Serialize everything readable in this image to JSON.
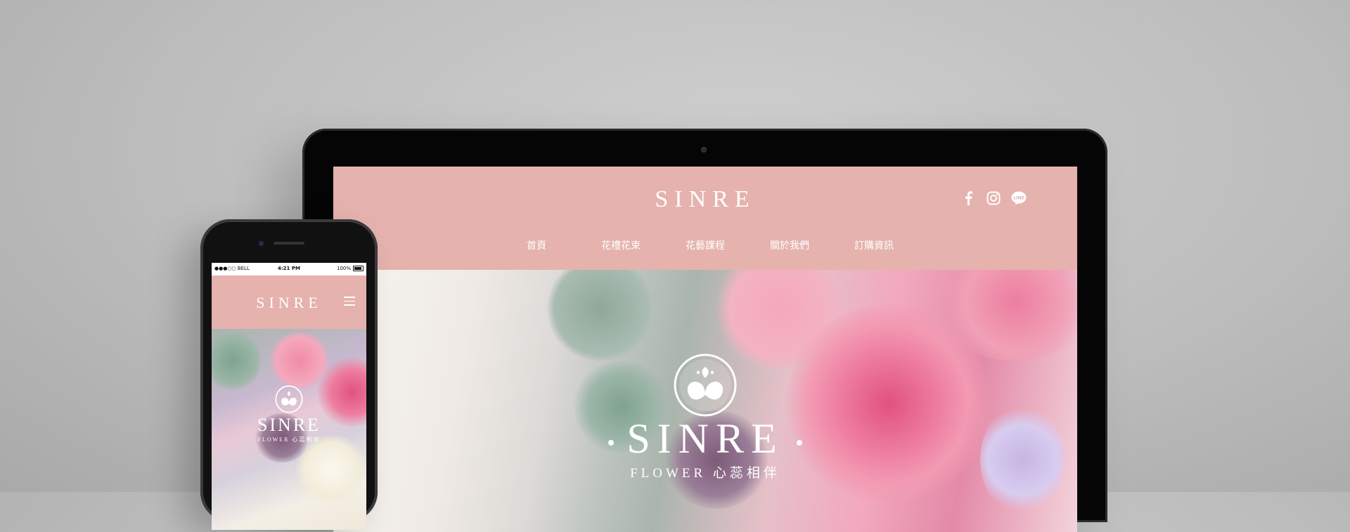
{
  "laptop": {
    "site": {
      "logo": "SINRE",
      "social": [
        {
          "icon": "facebook-icon"
        },
        {
          "icon": "instagram-icon"
        },
        {
          "icon": "line-icon",
          "text": "LINE"
        }
      ],
      "nav": [
        "首頁",
        "花禮花束",
        "花藝課程",
        "關於我們",
        "訂購資訊"
      ],
      "hero": {
        "title": "SINRE",
        "subtitle": "FLOWER 心蕊相伴",
        "emblem": "flower-emblem-icon"
      }
    }
  },
  "phone": {
    "status": {
      "carrier": "●●●○○ BELL",
      "time": "4:21 PM",
      "battery": "100%"
    },
    "site": {
      "logo": "SINRE",
      "menu_icon": "hamburger-menu-icon",
      "hero": {
        "title": "SINRE",
        "subtitle": "FLOWER 心蕊相伴"
      }
    }
  },
  "colors": {
    "header_pink": "#e5b2ae",
    "frame": "#050505",
    "background": "#bdbdbd"
  }
}
